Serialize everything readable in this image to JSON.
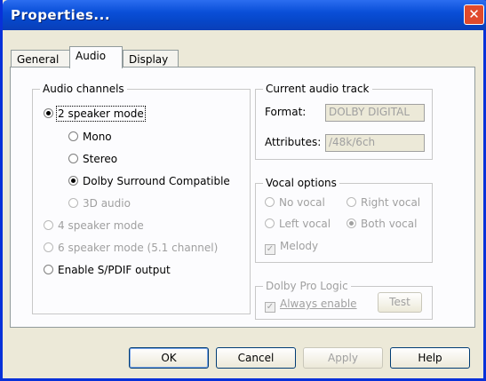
{
  "window": {
    "title": "Properties...",
    "close_glyph": "✕"
  },
  "tabs": [
    {
      "label": "General"
    },
    {
      "label": "Audio"
    },
    {
      "label": "Display"
    }
  ],
  "audio_channels": {
    "title": "Audio channels",
    "two_speaker": {
      "label": "2 speaker mode",
      "selected": true
    },
    "sub_modes": {
      "mono": {
        "label": "Mono",
        "selected": false
      },
      "stereo": {
        "label": "Stereo",
        "selected": false
      },
      "dolby": {
        "label": "Dolby Surround Compatible",
        "selected": true
      },
      "three_d": {
        "label": "3D audio",
        "selected": false,
        "enabled": false
      }
    },
    "four_speaker": {
      "label": "4 speaker mode",
      "enabled": false
    },
    "six_speaker": {
      "label": "6 speaker mode (5.1 channel)",
      "enabled": false
    },
    "spdif": {
      "label": "Enable S/PDIF output",
      "selected": false
    }
  },
  "current_track": {
    "title": "Current audio track",
    "format_label": "Format:",
    "format_value": "DOLBY DIGITAL",
    "attributes_label": "Attributes:",
    "attributes_value": "/48k/6ch"
  },
  "vocal_options": {
    "title": "Vocal options",
    "no_vocal": "No vocal",
    "right_vocal": "Right vocal",
    "left_vocal": "Left vocal",
    "both_vocal": "Both vocal",
    "melody": "Melody",
    "melody_checked": true
  },
  "pro_logic": {
    "title": "Dolby Pro Logic",
    "always_enable": "Always enable",
    "always_enable_checked": true,
    "test_button": "Test"
  },
  "buttons": {
    "ok": "OK",
    "cancel": "Cancel",
    "apply": "Apply",
    "help": "Help"
  }
}
